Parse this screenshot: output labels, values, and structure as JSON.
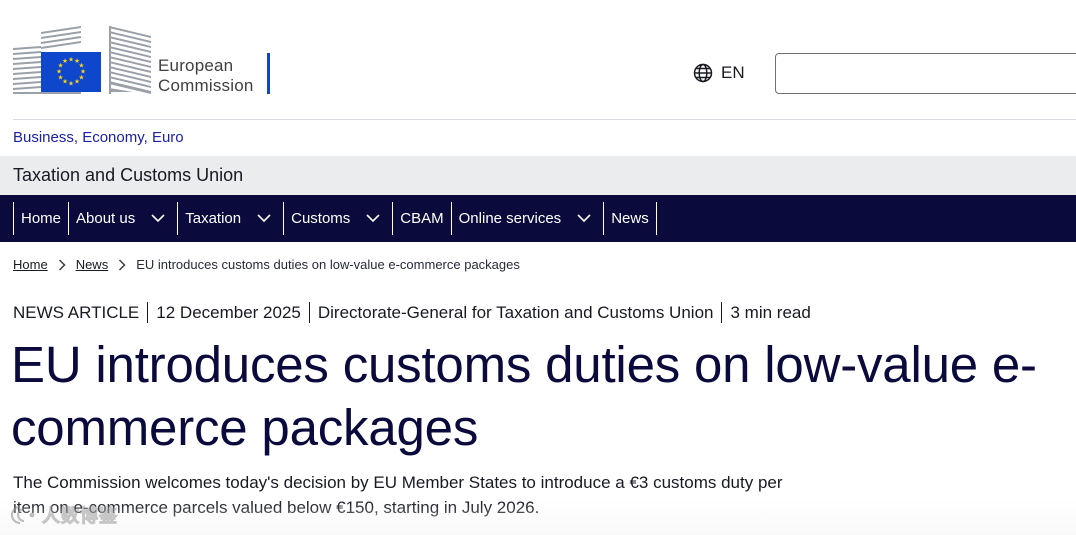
{
  "header": {
    "logo_line1": "European",
    "logo_line2": "Commission",
    "language_code": "EN",
    "search_value": ""
  },
  "site": {
    "context_link": "Business, Economy, Euro",
    "name": "Taxation and Customs Union"
  },
  "nav": {
    "items": [
      {
        "label": "Home",
        "has_dropdown": false
      },
      {
        "label": "About us",
        "has_dropdown": true
      },
      {
        "label": "Taxation",
        "has_dropdown": true
      },
      {
        "label": "Customs",
        "has_dropdown": true
      },
      {
        "label": "CBAM",
        "has_dropdown": false
      },
      {
        "label": "Online services",
        "has_dropdown": true
      },
      {
        "label": "News",
        "has_dropdown": false
      }
    ]
  },
  "breadcrumb": {
    "home": "Home",
    "news": "News",
    "current": "EU introduces customs duties on low-value e-commerce packages"
  },
  "article": {
    "type": "NEWS ARTICLE",
    "date": "12 December 2025",
    "author": "Directorate-General for Taxation and Customs Union",
    "read_time": "3 min read",
    "title": "EU introduces customs duties on low-value e-commerce packages",
    "lead": "The Commission welcomes today's decision by EU Member States to introduce a €3 customs duty per item on e-commerce parcels valued below €150, starting in July 2026."
  },
  "watermark": {
    "text": "人数博鉴"
  },
  "colors": {
    "nav_background": "#0a0a3c",
    "link": "#1c21a6",
    "title": "#0a0a3c",
    "eu_blue": "#0e47cb",
    "eu_star": "#ffd617",
    "site_name_bar": "#ebecee"
  }
}
